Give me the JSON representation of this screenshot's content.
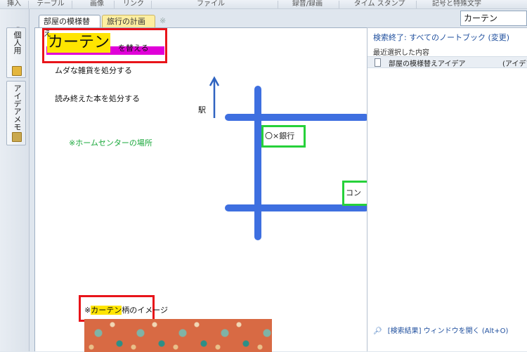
{
  "ribbon": {
    "groups": [
      "挿入",
      "テーブル",
      "画像",
      "リンク",
      "ファイル",
      "録音/録画",
      "タイム スタンプ",
      "記号と特殊文字"
    ]
  },
  "sidebar": {
    "notebooks": [
      {
        "label": "個人用",
        "icon": "notebook-icon"
      },
      {
        "label": "アイデアメモ",
        "icon": "book-icon"
      }
    ]
  },
  "tabs": {
    "items": [
      {
        "label": "部屋の模様替え",
        "color": "#ffffff"
      },
      {
        "label": "旅行の計画",
        "color": "#fdeea0"
      }
    ],
    "add_symbol": "※"
  },
  "page": {
    "title_big": "カーテン",
    "title_small": "を替える",
    "lines": [
      "ムダな雑貨を処分する",
      "読み終えた本を処分する"
    ],
    "homecenter_note": "※ホームセンターの場所",
    "map": {
      "station_label": "駅",
      "bank_label": "〇×銀行",
      "convenience_label": "コン"
    },
    "caption_prefix": "※",
    "caption_highlight": "カーテン",
    "caption_suffix": "柄のイメージ"
  },
  "search": {
    "query": "カーテン",
    "scope": "検索終了: すべてのノートブック (変更)",
    "recent_header": "最近選択した内容",
    "result_title": "部屋の模様替えアイデア",
    "result_section": "(アイデアメ",
    "open_results": "[検索結果] ウィンドウを開く (Alt+O)"
  },
  "colors": {
    "highlight_yellow": "#ffe500",
    "highlight_magenta": "#e000d8",
    "annotation_red": "#e8141a",
    "road_blue": "#3e6fe0",
    "poi_green": "#26d13a"
  }
}
